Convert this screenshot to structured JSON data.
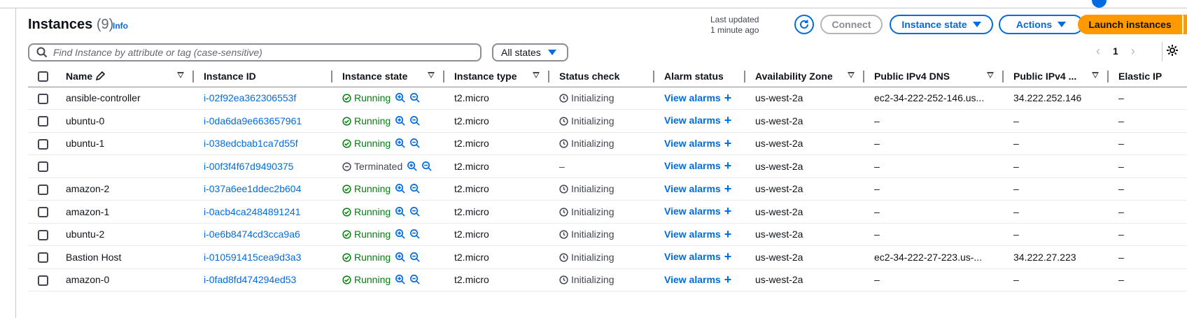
{
  "header": {
    "title": "Instances",
    "count": "(9)",
    "info_label": "Info",
    "last_updated_line1": "Last updated",
    "last_updated_line2": "1 minute ago",
    "connect_label": "Connect",
    "instance_state_label": "Instance state",
    "actions_label": "Actions",
    "launch_label": "Launch instances"
  },
  "filter": {
    "search_placeholder": "Find Instance by attribute or tag (case-sensitive)",
    "states_value": "All states"
  },
  "pagination": {
    "current_page": "1"
  },
  "colors": {
    "accent": "#006ce0",
    "launch": "#ff9900",
    "running": "#037f0c"
  },
  "table": {
    "columns": {
      "name": "Name",
      "instance_id": "Instance ID",
      "instance_state": "Instance state",
      "instance_type": "Instance type",
      "status_check": "Status check",
      "alarm_status": "Alarm status",
      "availability_zone": "Availability Zone",
      "public_dns": "Public IPv4 DNS",
      "public_ip": "Public IPv4 ...",
      "elastic_ip": "Elastic IP"
    },
    "rows": [
      {
        "name": "ansible-controller",
        "id": "i-02f92ea362306553f",
        "state": "Running",
        "type": "t2.micro",
        "status": "Initializing",
        "alarm": "View alarms",
        "az": "us-west-2a",
        "dns": "ec2-34-222-252-146.us...",
        "ip": "34.222.252.146",
        "eip": "–"
      },
      {
        "name": "ubuntu-0",
        "id": "i-0da6da9e663657961",
        "state": "Running",
        "type": "t2.micro",
        "status": "Initializing",
        "alarm": "View alarms",
        "az": "us-west-2a",
        "dns": "–",
        "ip": "–",
        "eip": "–"
      },
      {
        "name": "ubuntu-1",
        "id": "i-038edcbab1ca7d55f",
        "state": "Running",
        "type": "t2.micro",
        "status": "Initializing",
        "alarm": "View alarms",
        "az": "us-west-2a",
        "dns": "–",
        "ip": "–",
        "eip": "–"
      },
      {
        "name": "",
        "id": "i-00f3f4f67d9490375",
        "state": "Terminated",
        "type": "t2.micro",
        "status": "–",
        "alarm": "View alarms",
        "az": "us-west-2a",
        "dns": "–",
        "ip": "–",
        "eip": "–"
      },
      {
        "name": "amazon-2",
        "id": "i-037a6ee1ddec2b604",
        "state": "Running",
        "type": "t2.micro",
        "status": "Initializing",
        "alarm": "View alarms",
        "az": "us-west-2a",
        "dns": "–",
        "ip": "–",
        "eip": "–"
      },
      {
        "name": "amazon-1",
        "id": "i-0acb4ca2484891241",
        "state": "Running",
        "type": "t2.micro",
        "status": "Initializing",
        "alarm": "View alarms",
        "az": "us-west-2a",
        "dns": "–",
        "ip": "–",
        "eip": "–"
      },
      {
        "name": "ubuntu-2",
        "id": "i-0e6b8474cd3cca9a6",
        "state": "Running",
        "type": "t2.micro",
        "status": "Initializing",
        "alarm": "View alarms",
        "az": "us-west-2a",
        "dns": "–",
        "ip": "–",
        "eip": "–"
      },
      {
        "name": "Bastion Host",
        "id": "i-010591415cea9d3a3",
        "state": "Running",
        "type": "t2.micro",
        "status": "Initializing",
        "alarm": "View alarms",
        "az": "us-west-2a",
        "dns": "ec2-34-222-27-223.us-...",
        "ip": "34.222.27.223",
        "eip": "–"
      },
      {
        "name": "amazon-0",
        "id": "i-0fad8fd474294ed53",
        "state": "Running",
        "type": "t2.micro",
        "status": "Initializing",
        "alarm": "View alarms",
        "az": "us-west-2a",
        "dns": "–",
        "ip": "–",
        "eip": "–"
      }
    ]
  }
}
